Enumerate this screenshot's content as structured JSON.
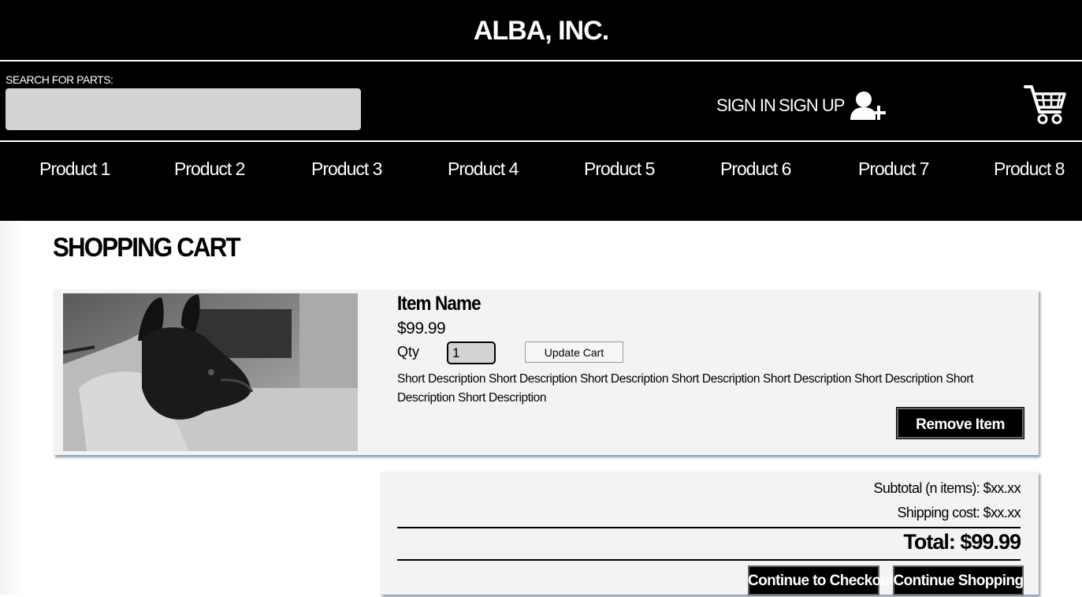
{
  "header": {
    "brand": "ALBA, INC.",
    "search_label": "SEARCH FOR PARTS:",
    "search_placeholder": "",
    "sign_in": "SIGN IN",
    "sign_up": "SIGN UP"
  },
  "nav": {
    "items": [
      "Product 1",
      "Product 2",
      "Product 3",
      "Product 4",
      "Product 5",
      "Product 6",
      "Product 7",
      "Product 8"
    ]
  },
  "page": {
    "title": "SHOPPING CART"
  },
  "cart_item": {
    "name": "Item Name",
    "price": "$99.99",
    "qty_label": "Qty",
    "qty_value": "1",
    "update_label": "Update Cart",
    "description": "Short Description Short Description Short Description Short Description Short Description Short Description Short Description Short Description",
    "remove_label": "Remove Item"
  },
  "summary": {
    "subtotal": "Subtotal (n items): $xx.xx",
    "shipping": "Shipping cost: $xx.xx",
    "total": "Total: $99.99",
    "checkout_label": "Continue to Checkout",
    "shopping_label": "Continue Shopping"
  },
  "colors": {
    "header_bg": "#000000",
    "panel_bg": "#f3f3f3",
    "input_bg": "#d3d3d3"
  }
}
